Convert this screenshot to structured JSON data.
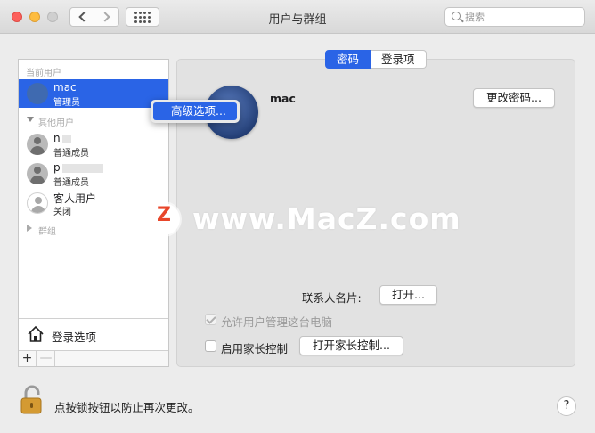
{
  "window": {
    "title": "用户与群组"
  },
  "search": {
    "placeholder": "搜索",
    "value": ""
  },
  "sidebar": {
    "current_header": "当前用户",
    "current_user": {
      "name": "mac",
      "role": "管理员"
    },
    "others_header": "其他用户",
    "other_users": [
      {
        "name": "n",
        "role": "普通成员"
      },
      {
        "name": "p",
        "role": "普通成员"
      },
      {
        "name": "客人用户",
        "role": "关闭"
      }
    ],
    "groups_header": "群组",
    "login_options": "登录选项",
    "add": "+",
    "remove": "—"
  },
  "context_menu": {
    "item": "高级选项..."
  },
  "tabs": {
    "password": "密码",
    "login_items": "登录项",
    "active": "password"
  },
  "account": {
    "name": "mac",
    "change_password": "更改密码..."
  },
  "contact_card": {
    "label": "联系人名片:",
    "button": "打开..."
  },
  "allow_admin": {
    "label": "允许用户管理这台电脑",
    "checked": true,
    "enabled": false
  },
  "parental": {
    "label": "启用家长控制",
    "checked": false,
    "button": "打开家长控制..."
  },
  "watermark": {
    "badge": "Z",
    "text": "www.MacZ.com"
  },
  "footer": {
    "lock_text": "点按锁按钮以防止再次更改。",
    "help": "?"
  },
  "colors": {
    "accent": "#2a64e6",
    "watermark_badge": "#e8462a"
  },
  "icons": [
    "search-icon",
    "back-chevron-icon",
    "forward-chevron-icon",
    "grid-icon",
    "house-icon",
    "lock-icon",
    "help-icon"
  ]
}
